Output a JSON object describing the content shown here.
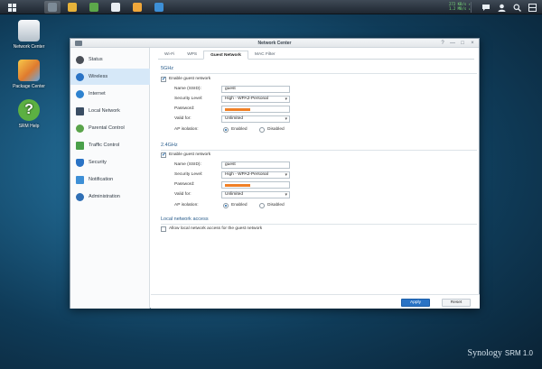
{
  "taskbar": {
    "net_up": "272 KB/s ↑",
    "net_down": "1.2 MB/s ↓"
  },
  "desktop": {
    "icons": [
      {
        "label": "Network Center"
      },
      {
        "label": "Package Center"
      },
      {
        "label": "SRM Help"
      }
    ]
  },
  "window": {
    "title": "Network Center",
    "controls": {
      "help": "?",
      "minimize": "—",
      "maximize": "□",
      "close": "×"
    }
  },
  "sidebar": {
    "items": [
      {
        "label": "Status",
        "icon": "status-icon"
      },
      {
        "label": "Wireless",
        "icon": "wireless-icon"
      },
      {
        "label": "Internet",
        "icon": "globe-icon"
      },
      {
        "label": "Local Network",
        "icon": "local-network-icon"
      },
      {
        "label": "Parental Control",
        "icon": "parental-control-icon"
      },
      {
        "label": "Traffic Control",
        "icon": "traffic-control-icon"
      },
      {
        "label": "Security",
        "icon": "shield-icon"
      },
      {
        "label": "Notification",
        "icon": "notification-icon"
      },
      {
        "label": "Administration",
        "icon": "tools-icon"
      }
    ],
    "selected": "Wireless"
  },
  "tabs": [
    {
      "label": "Wi-Fi"
    },
    {
      "label": "WPS"
    },
    {
      "label": "Guest Network"
    },
    {
      "label": "MAC Filter"
    }
  ],
  "active_tab": "Guest Network",
  "band5": {
    "title": "5GHz",
    "enable_label": "Enable guest network",
    "ssid_label": "Name (SSID):",
    "ssid_value": "guest",
    "security_label": "Security Level:",
    "security_value": "High - WPA2-Personal",
    "password_label": "Password:",
    "valid_label": "Valid for:",
    "valid_value": "Unlimited",
    "ap_label": "AP isolation:",
    "enabled_label": "Enabled",
    "disabled_label": "Disabled"
  },
  "band24": {
    "title": "2.4GHz",
    "enable_label": "Enable guest network",
    "ssid_label": "Name (SSID):",
    "ssid_value": "guest",
    "security_label": "Security Level:",
    "security_value": "High - WPA2-Personal",
    "password_label": "Password:",
    "valid_label": "Valid for:",
    "valid_value": "Unlimited",
    "ap_label": "AP isolation:",
    "enabled_label": "Enabled",
    "disabled_label": "Disabled"
  },
  "local_access": {
    "title": "Local network access",
    "checkbox_label": "Allow local network access for the guest network"
  },
  "footer": {
    "apply_label": "Apply",
    "reset_label": "Reset"
  },
  "brand": {
    "name": "Synology",
    "product": "SRM 1.0"
  },
  "colors": {
    "accent": "#2a73c5",
    "selection": "#d6e8f8",
    "password_mask": "#f08026"
  }
}
